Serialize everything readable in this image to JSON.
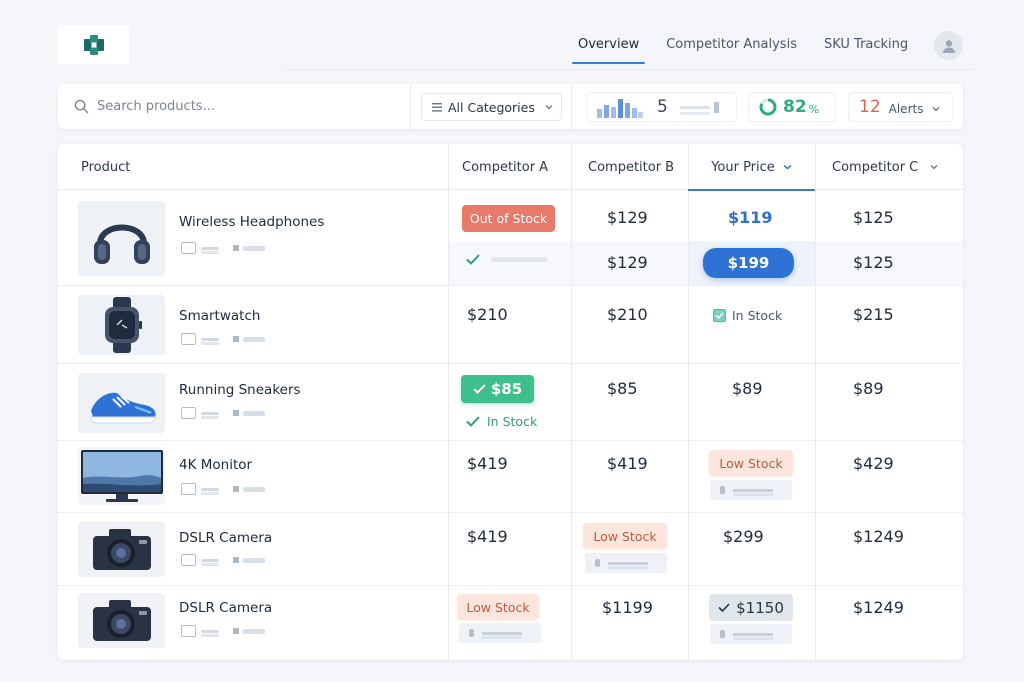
{
  "nav": {
    "tabs": [
      {
        "label": "Overview",
        "active": true
      },
      {
        "label": "Competitor Analysis",
        "active": false
      },
      {
        "label": "SKU Tracking",
        "active": false
      }
    ]
  },
  "toolbar": {
    "search_placeholder": "Search products...",
    "category_select": "All Categories",
    "tracked_count": "5",
    "match_percent": "82",
    "match_percent_unit": "%",
    "alerts_count": "12",
    "alerts_label": "Alerts"
  },
  "table": {
    "headers": {
      "product": "Product",
      "competitor_a": "Competitor A",
      "competitor_b": "Competitor B",
      "your_price": "Your Price",
      "competitor_c": "Competitor C"
    },
    "rows": [
      {
        "name": "Wireless Headphones",
        "thumb": "headphones-image",
        "comp_a": "Out of Stock",
        "comp_b": "$129",
        "your_price": "$119",
        "comp_c": "$125",
        "sub_comp_b": "$129",
        "sub_your_price": "$199",
        "sub_comp_c": "$125"
      },
      {
        "name": "Smartwatch",
        "thumb": "smartwatch-image",
        "comp_a": "$210",
        "comp_b": "$210",
        "your_price": "In Stock",
        "comp_c": "$215"
      },
      {
        "name": "Running Sneakers",
        "thumb": "sneakers-image",
        "comp_a": "$85",
        "comp_a_stock": "In Stock",
        "comp_b": "$85",
        "your_price": "$89",
        "comp_c": "$89"
      },
      {
        "name": "4K Monitor",
        "thumb": "monitor-image",
        "comp_a": "$419",
        "comp_b": "$419",
        "your_price": "Low Stock",
        "comp_c": "$429"
      },
      {
        "name": "DSLR Camera",
        "thumb": "camera-image",
        "comp_a": "$419",
        "comp_b": "Low Stock",
        "your_price": "$299",
        "comp_c": "$1249"
      },
      {
        "name": "DSLR Camera",
        "thumb": "camera-image",
        "comp_a": "Low Stock",
        "comp_b": "$1199",
        "your_price": "$1150",
        "comp_c": "$1249"
      }
    ]
  },
  "colors": {
    "accent": "#2f72d6",
    "success": "#3fbf8c",
    "danger": "#e77a69",
    "warning_bg": "#fbe5dc",
    "alert_text": "#e2604a"
  }
}
